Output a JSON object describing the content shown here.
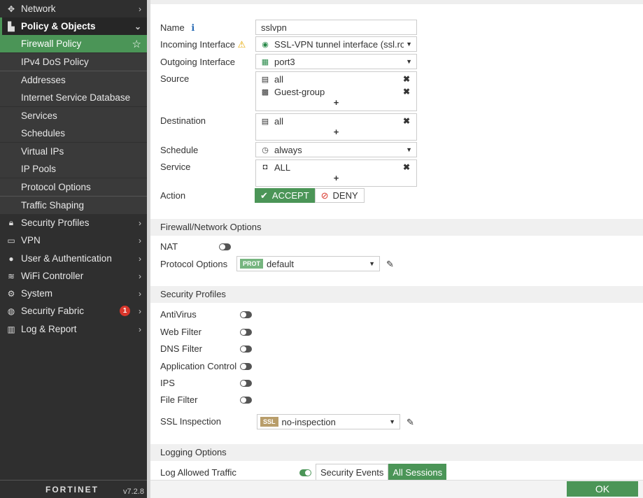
{
  "sidebar": {
    "items": [
      {
        "label": "Network",
        "icon": "move-arrows-icon"
      },
      {
        "label": "Policy & Objects",
        "icon": "clipboard-icon"
      },
      {
        "label": "Firewall Policy"
      },
      {
        "label": "IPv4 DoS Policy"
      },
      {
        "label": "Addresses"
      },
      {
        "label": "Internet Service Database"
      },
      {
        "label": "Services"
      },
      {
        "label": "Schedules"
      },
      {
        "label": "Virtual IPs"
      },
      {
        "label": "IP Pools"
      },
      {
        "label": "Protocol Options"
      },
      {
        "label": "Traffic Shaping"
      },
      {
        "label": "Security Profiles",
        "icon": "lock-icon"
      },
      {
        "label": "VPN",
        "icon": "laptop-icon"
      },
      {
        "label": "User & Authentication",
        "icon": "user-icon"
      },
      {
        "label": "WiFi Controller",
        "icon": "wifi-icon"
      },
      {
        "label": "System",
        "icon": "gear-icon"
      },
      {
        "label": "Security Fabric",
        "icon": "fabric-icon",
        "badge": "1"
      },
      {
        "label": "Log & Report",
        "icon": "chart-icon"
      }
    ],
    "logo": "FORTINET",
    "version": "v7.2.8"
  },
  "form": {
    "name_label": "Name",
    "name_value": "sslvpn",
    "incoming_label": "Incoming Interface",
    "incoming_value": "SSL-VPN tunnel interface (ssl.root)",
    "outgoing_label": "Outgoing Interface",
    "outgoing_value": "port3",
    "source_label": "Source",
    "source_items": [
      "all",
      "Guest-group"
    ],
    "destination_label": "Destination",
    "destination_items": [
      "all"
    ],
    "schedule_label": "Schedule",
    "schedule_value": "always",
    "service_label": "Service",
    "service_items": [
      "ALL"
    ],
    "action_label": "Action",
    "accept": "ACCEPT",
    "deny": "DENY",
    "action_selected": "ACCEPT",
    "plus": "+"
  },
  "firewall_options": {
    "title": "Firewall/Network Options",
    "nat_label": "NAT",
    "nat_on": false,
    "protocol_label": "Protocol Options",
    "protocol_tag": "PROT",
    "protocol_value": "default"
  },
  "security_profiles": {
    "title": "Security Profiles",
    "toggles": [
      {
        "label": "AntiVirus",
        "on": false
      },
      {
        "label": "Web Filter",
        "on": false
      },
      {
        "label": "DNS Filter",
        "on": false
      },
      {
        "label": "Application Control",
        "on": false
      },
      {
        "label": "IPS",
        "on": false
      },
      {
        "label": "File Filter",
        "on": false
      }
    ],
    "ssl_label": "SSL Inspection",
    "ssl_tag": "SSL",
    "ssl_value": "no-inspection"
  },
  "logging": {
    "title": "Logging Options",
    "log_allowed_label": "Log Allowed Traffic",
    "log_allowed_on": true,
    "security_events": "Security Events",
    "all_sessions": "All Sessions",
    "selected": "All Sessions"
  },
  "footer": {
    "ok": "OK"
  },
  "colors": {
    "accent": "#4b9557",
    "sidebar": "#2f2f2f",
    "badge": "#d9362b",
    "ssl_tag": "#b89d6a"
  }
}
